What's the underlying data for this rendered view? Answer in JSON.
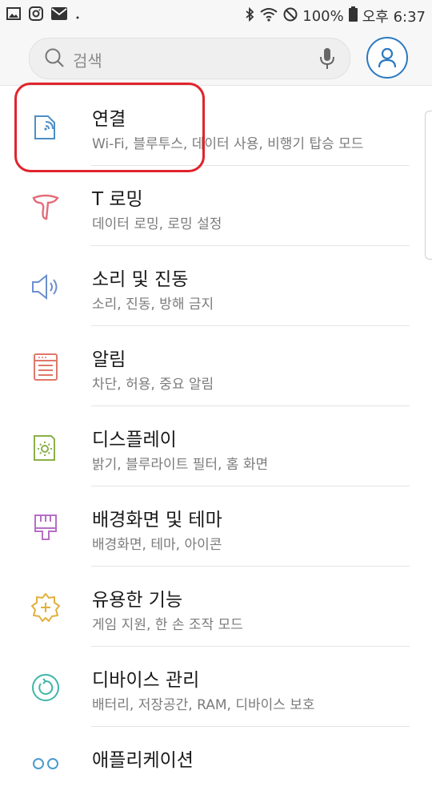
{
  "status_bar": {
    "battery": "100%",
    "time": "오후 6:37"
  },
  "search": {
    "placeholder": "검색"
  },
  "settings": [
    {
      "title": "연결",
      "subtitle": "Wi-Fi, 블루투스, 데이터 사용, 비행기 탑승 모드",
      "icon": "connection-icon"
    },
    {
      "title": "T 로밍",
      "subtitle": "데이터 로밍, 로밍 설정",
      "icon": "troaming-icon"
    },
    {
      "title": "소리 및 진동",
      "subtitle": "소리, 진동, 방해 금지",
      "icon": "speaker-icon"
    },
    {
      "title": "알림",
      "subtitle": "차단, 허용, 중요 알림",
      "icon": "notification-icon"
    },
    {
      "title": "디스플레이",
      "subtitle": "밝기, 블루라이트 필터, 홈 화면",
      "icon": "display-icon"
    },
    {
      "title": "배경화면 및 테마",
      "subtitle": "배경화면, 테마, 아이콘",
      "icon": "brush-icon"
    },
    {
      "title": "유용한 기능",
      "subtitle": "게임 지원, 한 손 조작 모드",
      "icon": "gear-plus-icon"
    },
    {
      "title": "디바이스 관리",
      "subtitle": "배터리, 저장공간, RAM, 디바이스 보호",
      "icon": "device-care-icon"
    },
    {
      "title": "애플리케이션",
      "subtitle": "",
      "icon": "apps-icon"
    }
  ],
  "colors": {
    "highlight": "#e0242c",
    "accent": "#2b79c0"
  }
}
